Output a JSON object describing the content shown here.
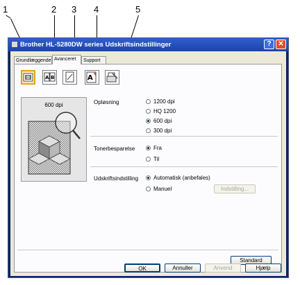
{
  "callouts": [
    "1",
    "2",
    "3",
    "4",
    "5"
  ],
  "window": {
    "title": "Brother HL-5280DW series Udskriftsindstillinger",
    "help_button": "?",
    "close_button": "✕"
  },
  "tabs": [
    {
      "label": "Grundlæggende"
    },
    {
      "label": "Avanceret",
      "active": true
    },
    {
      "label": "Support"
    }
  ],
  "toolbar_icons": [
    {
      "name": "quality-icon",
      "selected": true
    },
    {
      "name": "duplex-icon"
    },
    {
      "name": "watermark-icon"
    },
    {
      "name": "page-setting-icon"
    },
    {
      "name": "device-options-icon"
    }
  ],
  "preview": {
    "label": "600 dpi"
  },
  "resolution": {
    "label": "Opløsning",
    "options": [
      "1200 dpi",
      "HQ 1200",
      "600 dpi",
      "300 dpi"
    ],
    "selected_index": 2
  },
  "toner_save": {
    "label": "Tonerbesparelse",
    "options": [
      "Fra",
      "Til"
    ],
    "selected_index": 0
  },
  "print_setting": {
    "label": "Udskriftsindstilling",
    "options": [
      "Automatisk (anbefales)",
      "Manuel"
    ],
    "selected_index": 0,
    "setup_button": "Indstilling..."
  },
  "buttons": {
    "default": "Standard",
    "ok": "OK",
    "cancel": "Annuller",
    "apply": "Anvend",
    "help": "Hjælp"
  },
  "colors": {
    "accent": "#e3a21a",
    "titlebar": "#2f5fcf",
    "close": "#d9502c"
  }
}
